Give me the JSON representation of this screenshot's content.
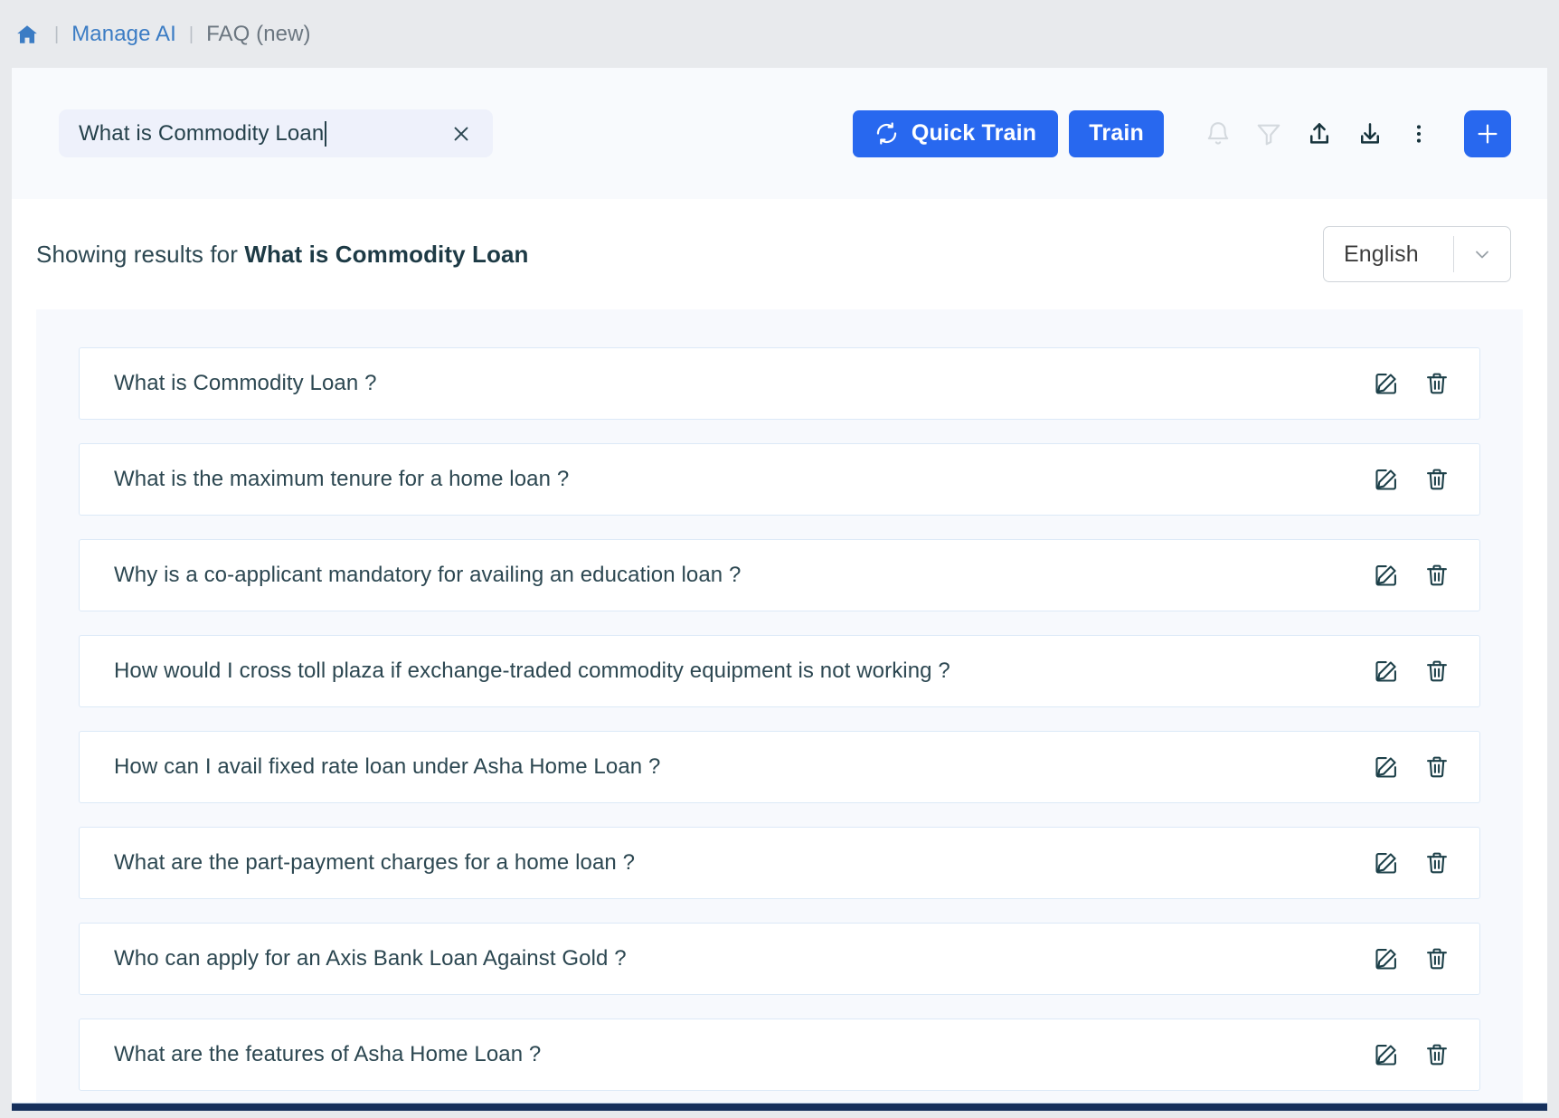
{
  "breadcrumb": {
    "home_icon": "home-icon",
    "separator": "|",
    "link": "Manage AI",
    "current": "FAQ (new)"
  },
  "toolbar": {
    "search": {
      "value": "What is Commodity Loan",
      "placeholder": "Search",
      "clear_icon": "close-icon"
    },
    "quick_train_label": "Quick Train",
    "quick_train_icon": "refresh-icon",
    "train_label": "Train",
    "icons": [
      {
        "name": "bell-icon",
        "state": "disabled"
      },
      {
        "name": "filter-icon",
        "state": "disabled"
      },
      {
        "name": "upload-icon",
        "state": "enabled"
      },
      {
        "name": "download-icon",
        "state": "enabled"
      },
      {
        "name": "more-vertical-icon",
        "state": "enabled"
      }
    ],
    "add_icon": "plus-icon",
    "accent_color": "#2868ef"
  },
  "results": {
    "showing_prefix": "Showing results for ",
    "showing_query": "What is Commodity Loan",
    "language": {
      "selected": "English",
      "chevron_icon": "chevron-down-icon"
    }
  },
  "faq_list": {
    "edit_icon": "edit-icon",
    "delete_icon": "trash-icon",
    "rows": [
      {
        "question": "What is Commodity Loan ?"
      },
      {
        "question": "What is the maximum tenure for a home loan ?"
      },
      {
        "question": "Why is a co-applicant mandatory for availing an education loan ?"
      },
      {
        "question": "How would I cross toll plaza if exchange-traded commodity equipment is not working ?"
      },
      {
        "question": "How can I avail fixed rate loan under Asha Home Loan ?"
      },
      {
        "question": "What are the part-payment charges for a home loan ?"
      },
      {
        "question": "Who can apply for an Axis Bank Loan Against Gold ?"
      },
      {
        "question": "What are the features of Asha Home Loan ?"
      }
    ]
  }
}
